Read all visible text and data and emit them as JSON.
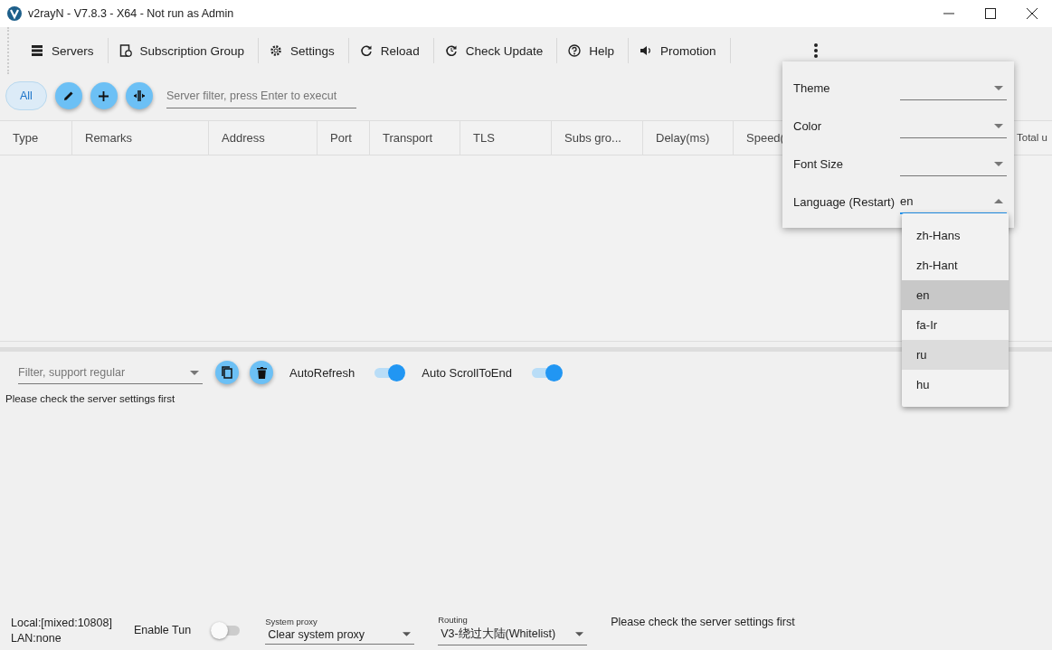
{
  "window": {
    "title": "v2rayN - V7.8.3 - X64 - Not run as Admin"
  },
  "toolbar": [
    {
      "label": "Servers"
    },
    {
      "label": "Subscription Group"
    },
    {
      "label": "Settings"
    },
    {
      "label": "Reload"
    },
    {
      "label": "Check Update"
    },
    {
      "label": "Help"
    },
    {
      "label": "Promotion"
    }
  ],
  "group_tabs": [
    {
      "label": "All",
      "selected": true
    }
  ],
  "server_filter": {
    "placeholder": "Server filter, press Enter to execut"
  },
  "table": {
    "columns": [
      "Type",
      "Remarks",
      "Address",
      "Port",
      "Transport",
      "TLS",
      "Subs gro...",
      "Delay(ms)",
      "Speed(",
      "Total u"
    ]
  },
  "log": {
    "filter_placeholder": "Filter, support regular",
    "toggles": [
      {
        "label": "AutoRefresh",
        "on": true
      },
      {
        "label": "Auto ScrollToEnd",
        "on": true
      }
    ],
    "message": "Please check the server settings first"
  },
  "settings_popup": {
    "fields": [
      {
        "label": "Theme",
        "open": false
      },
      {
        "label": "Color",
        "open": false
      },
      {
        "label": "Font Size",
        "open": false
      },
      {
        "label": "Language (Restart)",
        "value": "en",
        "open": true
      }
    ],
    "options": [
      {
        "label": "zh-Hans",
        "selected": false,
        "hovered": false
      },
      {
        "label": "zh-Hant",
        "selected": false,
        "hovered": false
      },
      {
        "label": "en",
        "selected": true,
        "hovered": false
      },
      {
        "label": "fa-Ir",
        "selected": false,
        "hovered": false
      },
      {
        "label": "ru",
        "selected": false,
        "hovered": true
      },
      {
        "label": "hu",
        "selected": false,
        "hovered": false
      }
    ]
  },
  "status_bar": {
    "local": "Local:[mixed:10808]",
    "lan": "LAN:none",
    "tun": {
      "label": "Enable Tun",
      "on": false
    },
    "system_proxy": {
      "label": "System proxy",
      "value": "Clear system proxy"
    },
    "routing": {
      "label": "Routing",
      "value": "V3-绕过大陆(Whitelist)"
    },
    "message": "Please check the server settings first"
  }
}
